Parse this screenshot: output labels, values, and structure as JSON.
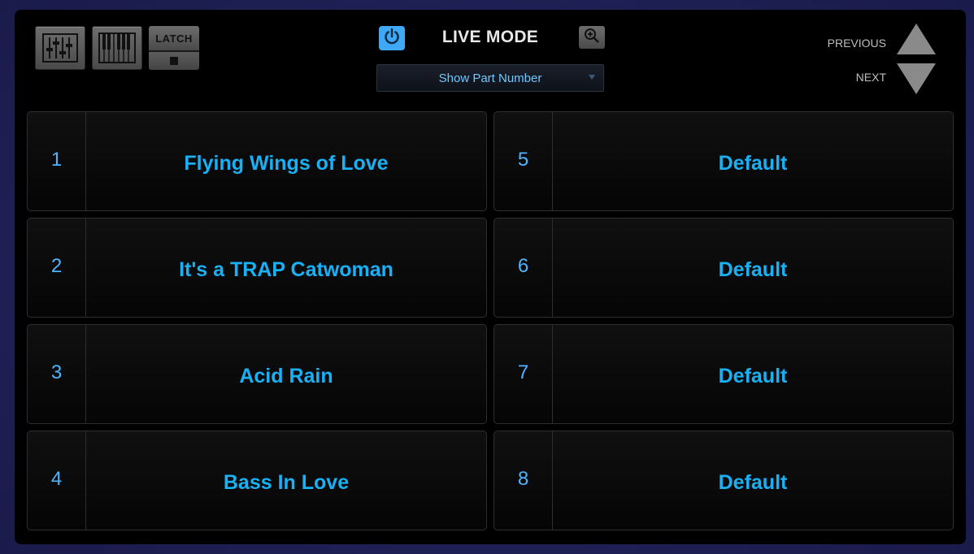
{
  "header": {
    "title": "LIVE MODE",
    "latch_label": "LATCH",
    "dropdown_value": "Show Part Number",
    "previous_label": "PREVIOUS",
    "next_label": "NEXT"
  },
  "icons": {
    "mixer": "mixer-icon",
    "keyboard": "keyboard-icon",
    "power": "power-icon",
    "zoom": "zoom-in-icon",
    "stop": "stop-icon",
    "previous": "arrow-up-icon",
    "next": "arrow-down-icon"
  },
  "colors": {
    "accent": "#3fa9f5",
    "part_name": "#18b1f5",
    "part_number": "#4fb4ff"
  },
  "parts": [
    {
      "number": "1",
      "name": "Flying Wings of Love"
    },
    {
      "number": "5",
      "name": "Default"
    },
    {
      "number": "2",
      "name": "It's a TRAP Catwoman"
    },
    {
      "number": "6",
      "name": "Default"
    },
    {
      "number": "3",
      "name": "Acid Rain"
    },
    {
      "number": "7",
      "name": "Default"
    },
    {
      "number": "4",
      "name": "Bass In Love"
    },
    {
      "number": "8",
      "name": "Default"
    }
  ]
}
